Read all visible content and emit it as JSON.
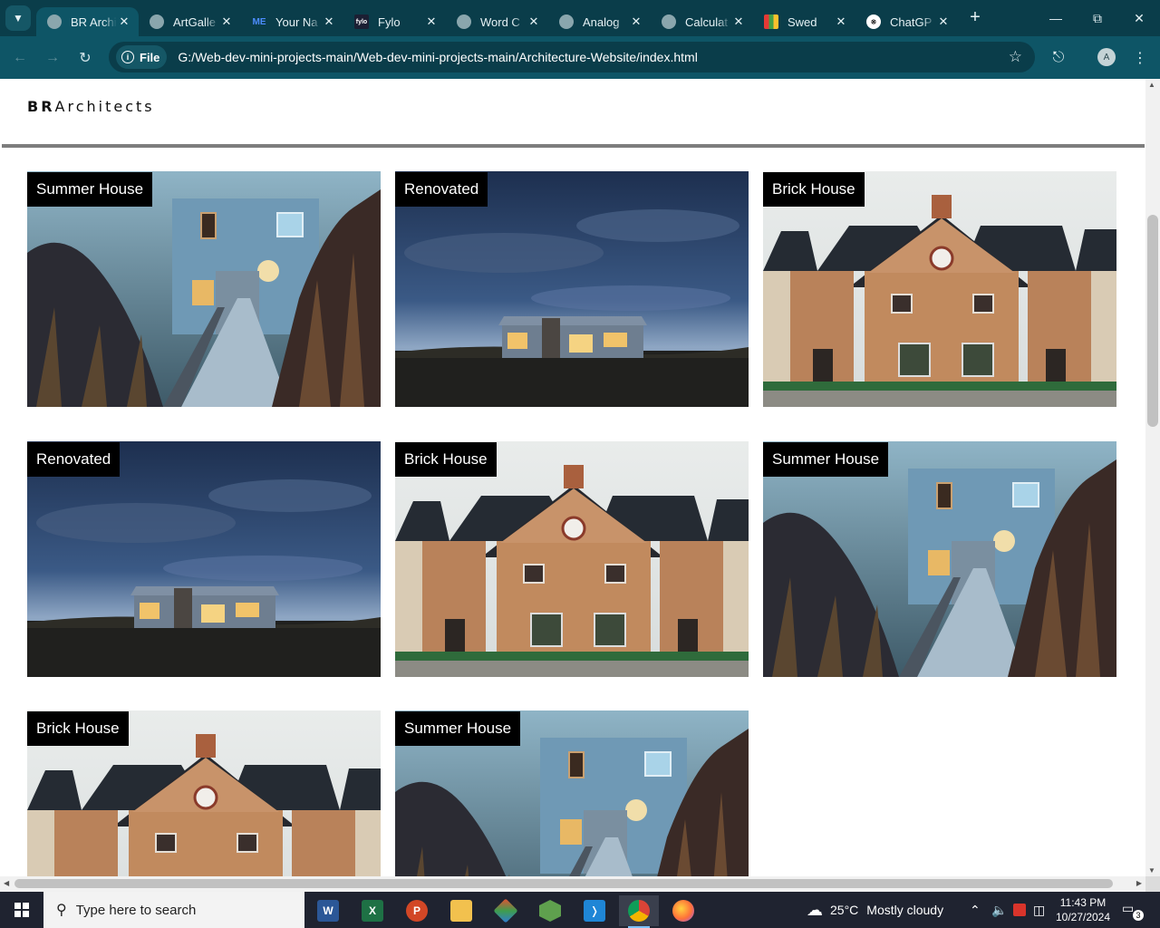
{
  "browser": {
    "tabs": [
      {
        "title": "BR Archi",
        "active": true,
        "icon": "globe-icon"
      },
      {
        "title": "ArtGalle",
        "icon": "globe-icon"
      },
      {
        "title": "Your Na",
        "icon": "me-logo-icon"
      },
      {
        "title": "Fylo",
        "icon": "fylo-logo-icon"
      },
      {
        "title": "Word C",
        "icon": "globe-icon"
      },
      {
        "title": "Analog",
        "icon": "globe-icon"
      },
      {
        "title": "Calculat",
        "icon": "globe-icon"
      },
      {
        "title": "Swed",
        "icon": "swedish-flag-icon"
      },
      {
        "title": "ChatGP",
        "icon": "chatgpt-icon"
      }
    ],
    "address_chip": "File",
    "url": "G:/Web-dev-mini-projects-main/Web-dev-mini-projects-main/Architecture-Website/index.html",
    "profile_initial": "A"
  },
  "site": {
    "brand_bold": "BR",
    "brand_rest": "Architects",
    "projects": [
      {
        "label": "Summer House",
        "photo": "summer"
      },
      {
        "label": "Renovated",
        "photo": "renovated"
      },
      {
        "label": "Brick House",
        "photo": "brick"
      },
      {
        "label": "Renovated",
        "photo": "renovated"
      },
      {
        "label": "Brick House",
        "photo": "brick"
      },
      {
        "label": "Summer House",
        "photo": "summer"
      },
      {
        "label": "Brick House",
        "photo": "brick"
      },
      {
        "label": "Summer House",
        "photo": "summer"
      }
    ]
  },
  "taskbar": {
    "search_placeholder": "Type here to search",
    "weather_temp": "25°C",
    "weather_text": "Mostly cloudy",
    "time": "11:43 PM",
    "date": "10/27/2024",
    "notification_count": "3"
  },
  "colors": {
    "tab_strip": "#0a3d4a",
    "toolbar": "#0e5566",
    "label_bg": "#000000"
  }
}
